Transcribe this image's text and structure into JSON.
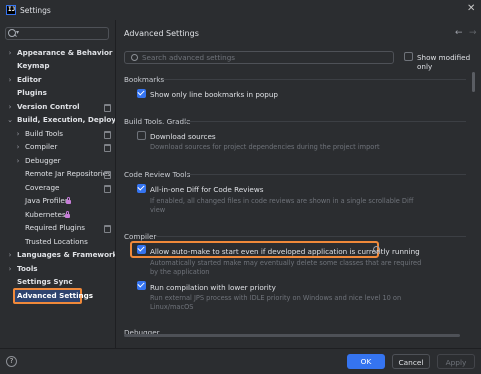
{
  "window": {
    "title": "Settings"
  },
  "sidebar": {
    "search_placeholder": "",
    "items": [
      {
        "label": "Appearance & Behavior"
      },
      {
        "label": "Keymap"
      },
      {
        "label": "Editor"
      },
      {
        "label": "Plugins"
      },
      {
        "label": "Version Control"
      },
      {
        "label": "Build, Execution, Deployment"
      },
      {
        "label": "Build Tools"
      },
      {
        "label": "Compiler"
      },
      {
        "label": "Debugger"
      },
      {
        "label": "Remote Jar Repositories"
      },
      {
        "label": "Coverage"
      },
      {
        "label": "Java Profiler"
      },
      {
        "label": "Kubernetes"
      },
      {
        "label": "Required Plugins"
      },
      {
        "label": "Trusted Locations"
      },
      {
        "label": "Languages & Frameworks"
      },
      {
        "label": "Tools"
      },
      {
        "label": "Settings Sync"
      },
      {
        "label": "Advanced Settings"
      }
    ]
  },
  "content": {
    "title": "Advanced Settings",
    "search_placeholder": "Search advanced settings",
    "show_modified_label": "Show modified only",
    "sections": {
      "bookmarks": {
        "title": "Bookmarks",
        "opt1": "Show only line bookmarks in popup"
      },
      "gradle": {
        "title": "Build Tools. Gradle",
        "opt1": "Download sources",
        "desc1": "Download sources for project dependencies during the project import"
      },
      "review": {
        "title": "Code Review Tools",
        "opt1": "All-in-one Diff for Code Reviews",
        "desc1a": "If enabled, all changed files in code reviews are shown in a single scrollable Diff",
        "desc1b": "view"
      },
      "compiler": {
        "title": "Compiler",
        "opt1": "Allow auto-make to start even if developed application is currently running",
        "desc1a": "Automatically started make may eventually delete some classes that are required",
        "desc1b": "by the application",
        "opt2": "Run compilation with lower priority",
        "desc2a": "Run external JPS process with IDLE priority on Windows and nice level 10 on",
        "desc2b": "Linux/macOS"
      },
      "debugger": {
        "title": "Debugger"
      }
    }
  },
  "footer": {
    "help": "?",
    "ok": "OK",
    "cancel": "Cancel",
    "apply": "Apply"
  },
  "colors": {
    "accent": "#3574f0",
    "highlight": "#f0893a",
    "background": "#2b2d30"
  }
}
